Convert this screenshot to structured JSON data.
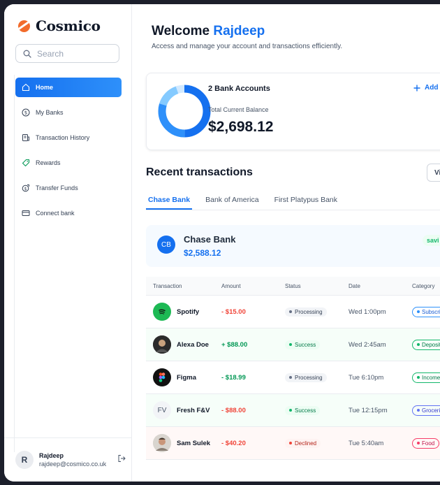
{
  "app": {
    "name": "Cosmico"
  },
  "search": {
    "placeholder": "Search"
  },
  "sidebar": {
    "items": [
      {
        "label": "Home",
        "icon": "home-icon"
      },
      {
        "label": "My Banks",
        "icon": "dollar-circle-icon"
      },
      {
        "label": "Transaction History",
        "icon": "receipt-icon"
      },
      {
        "label": "Rewards",
        "icon": "tag-icon"
      },
      {
        "label": "Transfer Funds",
        "icon": "money-send-icon"
      },
      {
        "label": "Connect bank",
        "icon": "card-icon"
      }
    ]
  },
  "user": {
    "initial": "R",
    "name": "Rajdeep",
    "email": "rajdeep@cosmico.co.uk"
  },
  "header": {
    "welcome_prefix": "Welcome",
    "welcome_name": "Rajdeep",
    "subtitle": "Access and manage your account and transactions efficiently."
  },
  "balance": {
    "accounts_label": "2 Bank Accounts",
    "total_label": "Total Current Balance",
    "total_value": "$2,698.12",
    "add_label": "Add"
  },
  "recent": {
    "title": "Recent transactions",
    "view_all": "Vi"
  },
  "tabs": [
    "Chase Bank",
    "Bank of America",
    "First Platypus Bank"
  ],
  "bank_banner": {
    "initials": "CB",
    "name": "Chase Bank",
    "balance": "$2,588.12",
    "badge": "savi"
  },
  "table": {
    "headers": [
      "Transaction",
      "Amount",
      "Status",
      "Date",
      "Category"
    ],
    "rows": [
      {
        "name": "Spotify",
        "amount": "- $15.00",
        "status": "Processing",
        "date": "Wed 1:00pm",
        "category": "Subscrip"
      },
      {
        "name": "Alexa Doe",
        "amount": "+ $88.00",
        "status": "Success",
        "date": "Wed 2:45am",
        "category": "Deposit"
      },
      {
        "name": "Figma",
        "amount": "- $18.99",
        "status": "Processing",
        "date": "Tue 6:10pm",
        "category": "Income"
      },
      {
        "name": "Fresh F&V",
        "avatar_text": "FV",
        "amount": "- $88.00",
        "status": "Success",
        "date": "Tue 12:15pm",
        "category": "Groceries"
      },
      {
        "name": "Sam Sulek",
        "amount": "- $40.20",
        "status": "Declined",
        "date": "Tue 5:40am",
        "category": "Food"
      }
    ]
  },
  "colors": {
    "accent": "#1570ef",
    "success": "#12b76a",
    "danger": "#f04438"
  }
}
